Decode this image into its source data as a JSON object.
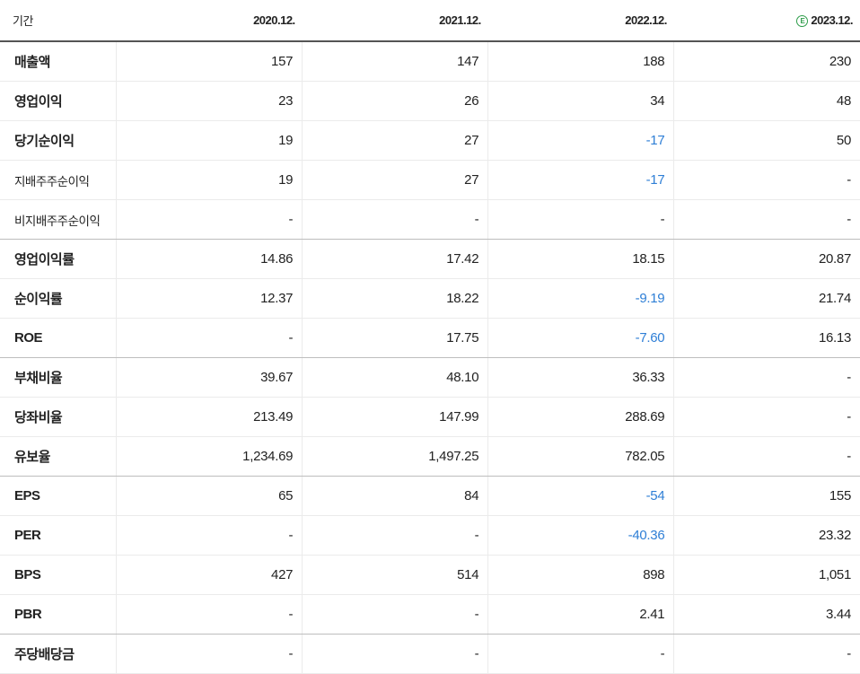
{
  "header": {
    "label": "기간",
    "periods": [
      "2020.12.",
      "2021.12.",
      "2022.12.",
      "2023.12."
    ],
    "estimate_icon": "E"
  },
  "colors": {
    "negative": "#2f7fd6",
    "estimate_icon": "#2e9d4a"
  },
  "rows": [
    {
      "label": "매출액",
      "sub": false,
      "group_end": false,
      "values": [
        "157",
        "147",
        "188",
        "230"
      ]
    },
    {
      "label": "영업이익",
      "sub": false,
      "group_end": false,
      "values": [
        "23",
        "26",
        "34",
        "48"
      ]
    },
    {
      "label": "당기순이익",
      "sub": false,
      "group_end": false,
      "values": [
        "19",
        "27",
        "-17",
        "50"
      ]
    },
    {
      "label": "지배주주순이익",
      "sub": true,
      "group_end": false,
      "values": [
        "19",
        "27",
        "-17",
        "-"
      ]
    },
    {
      "label": "비지배주주순이익",
      "sub": true,
      "group_end": true,
      "values": [
        "-",
        "-",
        "-",
        "-"
      ]
    },
    {
      "label": "영업이익률",
      "sub": false,
      "group_end": false,
      "values": [
        "14.86",
        "17.42",
        "18.15",
        "20.87"
      ]
    },
    {
      "label": "순이익률",
      "sub": false,
      "group_end": false,
      "values": [
        "12.37",
        "18.22",
        "-9.19",
        "21.74"
      ]
    },
    {
      "label": "ROE",
      "sub": false,
      "group_end": true,
      "values": [
        "-",
        "17.75",
        "-7.60",
        "16.13"
      ]
    },
    {
      "label": "부채비율",
      "sub": false,
      "group_end": false,
      "values": [
        "39.67",
        "48.10",
        "36.33",
        "-"
      ]
    },
    {
      "label": "당좌비율",
      "sub": false,
      "group_end": false,
      "values": [
        "213.49",
        "147.99",
        "288.69",
        "-"
      ]
    },
    {
      "label": "유보율",
      "sub": false,
      "group_end": true,
      "values": [
        "1,234.69",
        "1,497.25",
        "782.05",
        "-"
      ]
    },
    {
      "label": "EPS",
      "sub": false,
      "group_end": false,
      "values": [
        "65",
        "84",
        "-54",
        "155"
      ]
    },
    {
      "label": "PER",
      "sub": false,
      "group_end": false,
      "values": [
        "-",
        "-",
        "-40.36",
        "23.32"
      ]
    },
    {
      "label": "BPS",
      "sub": false,
      "group_end": false,
      "values": [
        "427",
        "514",
        "898",
        "1,051"
      ]
    },
    {
      "label": "PBR",
      "sub": false,
      "group_end": true,
      "values": [
        "-",
        "-",
        "2.41",
        "3.44"
      ]
    },
    {
      "label": "주당배당금",
      "sub": false,
      "group_end": false,
      "values": [
        "-",
        "-",
        "-",
        "-"
      ]
    }
  ]
}
